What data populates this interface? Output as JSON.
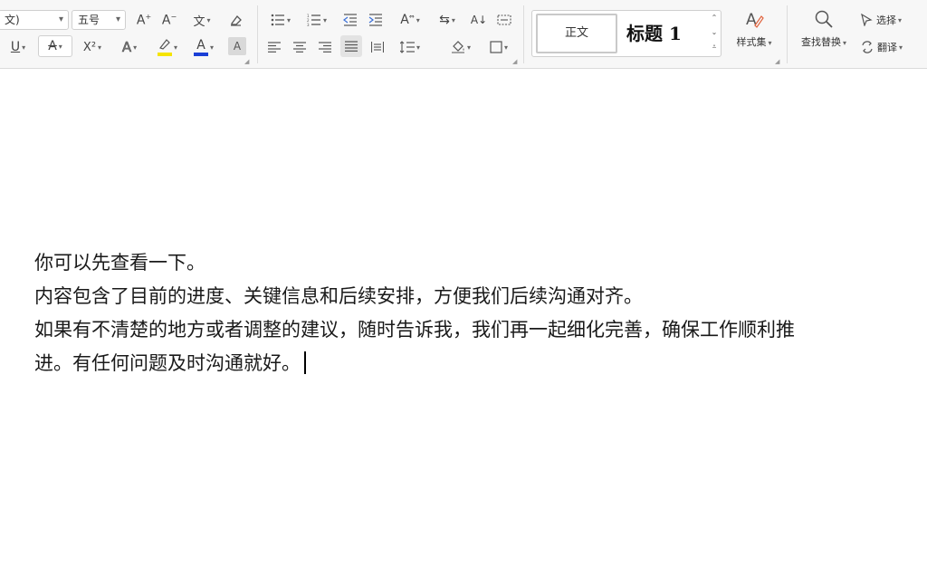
{
  "ribbon": {
    "font_name_value": "文)",
    "font_size_value": "五号",
    "style_normal_label": "正文",
    "style_heading_label": "标题 1",
    "styles_set_label": "样式集",
    "find_replace_label": "查找替换",
    "select_label": "选择",
    "translate_label": "翻译",
    "superscript_label": "X²",
    "highlight_color": "#f5e400",
    "font_color": "#1a3fd6"
  },
  "document": {
    "lines": [
      "你可以先查看一下。",
      "内容包含了目前的进度、关键信息和后续安排，方便我们后续沟通对齐。",
      "如果有不清楚的地方或者调整的建议，随时告诉我，我们再一起细化完善，确保工作顺利推",
      "进。有任何问题及时沟通就好。"
    ]
  }
}
